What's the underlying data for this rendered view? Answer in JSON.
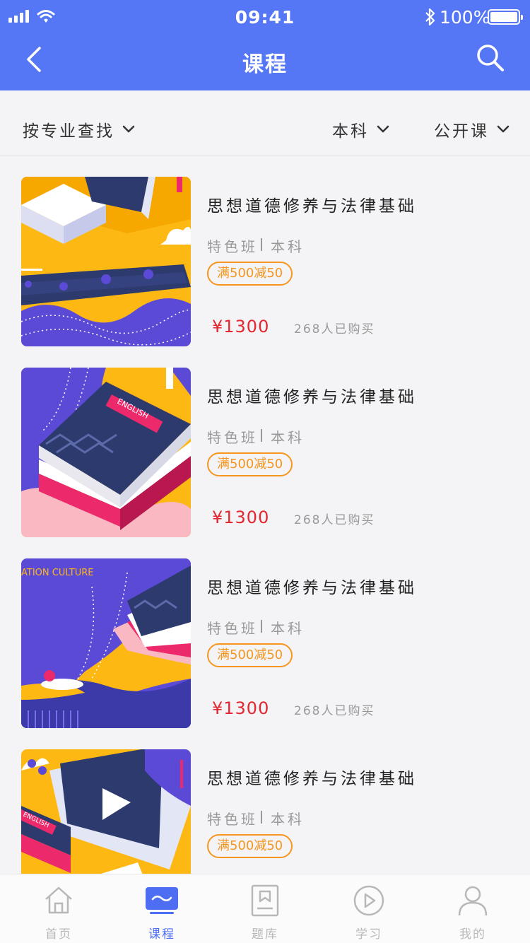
{
  "status_bar": {
    "time": "09:41",
    "battery": "100%"
  },
  "nav": {
    "title": "课程",
    "back_icon": "back-icon",
    "search_icon": "search-icon"
  },
  "filters": [
    {
      "label": "按专业查找"
    },
    {
      "label": "本科"
    },
    {
      "label": "公开课"
    }
  ],
  "courses": [
    {
      "title": "思想道德修养与法律基础",
      "tag1": "特色班",
      "tag2": "本科",
      "promo": "满500减50",
      "price": "¥1300",
      "buyers": "268人已购买"
    },
    {
      "title": "思想道德修养与法律基础",
      "tag1": "特色班",
      "tag2": "本科",
      "promo": "满500减50",
      "price": "¥1300",
      "buyers": "268人已购买",
      "thumb_text": "ENGLISH"
    },
    {
      "title": "思想道德修养与法律基础",
      "tag1": "特色班",
      "tag2": "本科",
      "promo": "满500减50",
      "price": "¥1300",
      "buyers": "268人已购买",
      "thumb_text": "ATION  CULTURE"
    },
    {
      "title": "思想道德修养与法律基础",
      "tag1": "特色班",
      "tag2": "本科",
      "promo": "满500减50",
      "price": "",
      "buyers": "",
      "thumb_text": "ENGLISH"
    }
  ],
  "tabbar": {
    "items": [
      {
        "label": "首页",
        "icon": "home-icon"
      },
      {
        "label": "课程",
        "icon": "course-icon",
        "active": true
      },
      {
        "label": "题库",
        "icon": "question-bank-icon"
      },
      {
        "label": "学习",
        "icon": "play-icon"
      },
      {
        "label": "我的",
        "icon": "profile-icon"
      }
    ]
  },
  "colors": {
    "primary": "#5577f5",
    "accent": "#f7961e",
    "price": "#e3262f",
    "tab_active": "#4d6ef2"
  }
}
